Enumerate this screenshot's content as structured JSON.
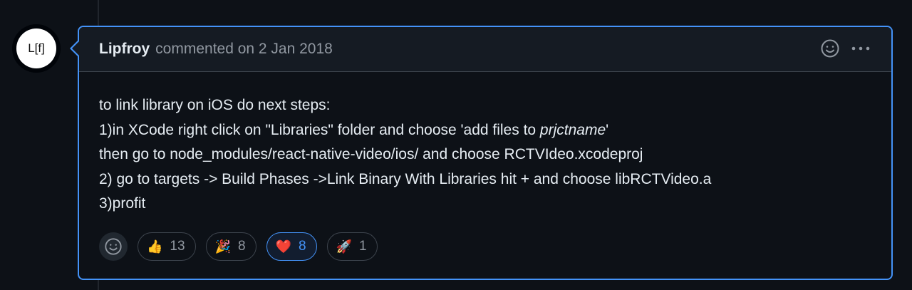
{
  "avatar": {
    "text": "L[f]"
  },
  "comment": {
    "author": "Lipfroy",
    "meta": "commented on 2 Jan 2018",
    "body": {
      "line1": "to link library on iOS do next steps:",
      "line2_pre": "1)in XCode right click on \"Libraries\" folder and choose 'add files to ",
      "line2_em": "prjctname",
      "line2_post": "'",
      "line3": "then go to node_modules/react-native-video/ios/ and choose RCTVIdeo.xcodeproj",
      "line4": "2) go to targets -> Build Phases ->Link Binary With Libraries hit + and choose libRCTVideo.a",
      "line5": "3)profit"
    },
    "header_icons": [
      "smiley-icon",
      "kebab-menu-icon"
    ]
  },
  "reactions": [
    {
      "emoji": "👍",
      "icon": "thumbs-up-icon",
      "count": "13",
      "active": false
    },
    {
      "emoji": "🎉",
      "icon": "party-popper-icon",
      "count": "8",
      "active": false
    },
    {
      "emoji": "❤️",
      "icon": "heart-icon",
      "count": "8",
      "active": true
    },
    {
      "emoji": "🚀",
      "icon": "rocket-icon",
      "count": "1",
      "active": false
    }
  ],
  "colors": {
    "accent": "#4493f8",
    "background": "#0d1117",
    "header_bg": "#151b23",
    "muted_text": "#9198a1"
  }
}
